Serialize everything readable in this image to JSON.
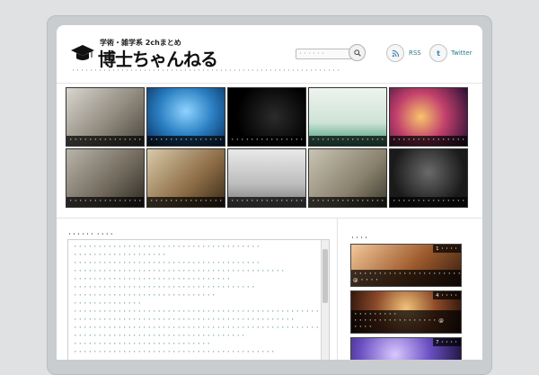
{
  "header": {
    "logo_small": "学術・雑学系 2chまとめ",
    "logo_big": "博士ちゃんねる",
    "tagline": "・・・・・・・・・・・・・・・・・・・・・・・・・・・・・・・・・・・・・・・・・・・・・・・・・・・・・・・・・・・・",
    "search_placeholder": "・・・・・・",
    "rss_label": "RSS",
    "twitter_label": "Twitter"
  },
  "grid": [
    {
      "caption": "・・・・・・・・・・・・・・・・・・・・",
      "bg": "linear-gradient(135deg,#d9d6cf,#8a8478 60%,#4b4740)"
    },
    {
      "caption": "・・・・・・・・・・・・・・・・・・・・・・・・",
      "bg": "radial-gradient(ellipse at 50% 40%,#8fd3ff,#2a7fc2 50%,#0a2c5a)"
    },
    {
      "caption": "・・・・・・・・・・・・・・・・・・・・・・・・・・・・",
      "bg": "radial-gradient(circle at 60% 50%,#2b2b2b,#000 70%)"
    },
    {
      "caption": "・・・・・・・・・・・・・・・・・・・・・",
      "bg": "linear-gradient(180deg,#eef3ef,#cfe3d6 60%,#3e9a78)"
    },
    {
      "caption": "・・・・・・・・・・・・・・・・・・・・・・・",
      "bg": "radial-gradient(circle at 40% 50%,#f7c46b,#c2416c 45%,#2b0f36)"
    },
    {
      "caption": "・・・・・・・・・・・・・・・・・・・・",
      "bg": "linear-gradient(135deg,#b9b4aa,#6f675a 60%,#2f2a24)"
    },
    {
      "caption": "・・・・・・・・・・・・・・・・・・・・・・・・・・",
      "bg": "linear-gradient(135deg,#d8c9a8,#8b6b45 60%,#3a2a18)"
    },
    {
      "caption": "・・・・・・・・・・・・・・・・・・・・・・・・・・・・",
      "bg": "linear-gradient(180deg,#e9e9e9,#bdbdbd 60%,#7a7a7a)"
    },
    {
      "caption": "・・・・・・・・・・・・・・・・・・・・・・",
      "bg": "linear-gradient(135deg,#c8c3b3,#8a826d 60%,#3f3a2e)"
    },
    {
      "caption": "・・・・・・・・・・・・・・・・・・・・・・・・",
      "bg": "radial-gradient(circle at 50% 40%,#6a6a6a,#1a1a1a 70%)"
    }
  ],
  "main": {
    "title": "・・・・・・ ・・・・",
    "items": [
      "・・・・・・・・・・・・・・・・・・・・・・・・・・・・・・・・・・・・・・",
      "・・・・・・・・・・・・・・・・・・・",
      "・・・・・・・・・・・・・・・・・・・・・・・・・・・・・・・・・・・・・・",
      "・・・・・・・・・・・・・・・・・・・・・・・・・・・・・・・・・・・・・・・・・・・",
      "・・・・・・・・・・・・・・・・・・・・・・・・・・・・・・・・",
      "・・・・・・・・・・・・・・・・・・・・・・・・・・・・・・・・・・・・・",
      "・・・・・・・・・・・・・・・・・・・・・・・・・・・・・",
      "・・・・・・・・・・・・・・",
      "・・・・・・・・・・・・・・・・・・・・・・・・・・・・・・・・・・・・・・・・・・・・・・・・・・・・・",
      "・・・・・・・・・・・・・・・・・・・・・・・・・・・・・・・・・・・・・・・・・・・・・",
      "・・・・・・・・・・・・・・・・・・・・・・・・・・・・・・・・・・・・・・・・・・・・・・・・・・・・・",
      "・・・・・・・・・・・・・・・・・・・・・・・・・・・・・・・・・・・",
      "・・・・・・・・・・・・・・・・・・・・・・・・・・・・",
      "・・・・・・・・・・・・・・・・・・・・・・・・・・・・・・・・・・・・・・・・・"
    ]
  },
  "sidebar": {
    "title": "・・・・",
    "items": [
      {
        "caption": "・・・・・・・・・・・・・・・・・・・・・・・・・・・・・・・・ @ ・・・・",
        "rank": "1 ・・・・",
        "bg": "linear-gradient(135deg,#f3c89a,#9e5b2d 55%,#2f1a0e)"
      },
      {
        "caption": "・・・・・・・・・ ・・・・・・・・・・・・・・・・・ @ ・・・・",
        "rank": "4 ・・・・",
        "bg": "radial-gradient(circle at 50% 40%,#f1c27a,#8c4a2a 50%,#2a1208)"
      },
      {
        "caption": "・・・・・・・・・・・・・・・・・・・・・・・・・・・・",
        "rank": "7 ・・・・",
        "bg": "radial-gradient(circle at 40% 40%,#d9c8ff,#6a4fc2 50%,#1a1036)"
      }
    ]
  }
}
